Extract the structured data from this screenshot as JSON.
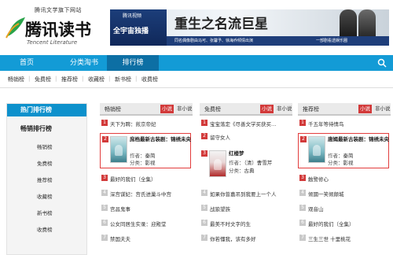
{
  "header": {
    "tagline": "腾讯文学旗下网站",
    "logo_text": "腾讯读书",
    "logo_sub": "Tencent Literature",
    "banner": {
      "brand": "腾讯视频",
      "exclusive": "全宇宙独播",
      "title": "重生之名流巨星",
      "caption": "同名偶像剧由马可、张馨予、徐海乔倾情出演",
      "caption_right": "一部剧看透娱乐圈"
    }
  },
  "nav": {
    "items": [
      "首页",
      "分类淘书",
      "排行榜"
    ],
    "active_index": 2,
    "search_icon": "search-icon"
  },
  "subnav": [
    "畅销榜",
    "免费榜",
    "推荐榜",
    "收藏榜",
    "新书榜",
    "收费榜"
  ],
  "sidebar": {
    "header": "热门排行榜",
    "section": "畅销排行榜",
    "items": [
      "畅销榜",
      "免费榜",
      "推荐榜",
      "收藏榜",
      "新书榜",
      "收费榜"
    ]
  },
  "columns": [
    {
      "title": "畅销榜",
      "tab_active": "小说",
      "tab_other": "非小说",
      "row1": "天下为聘：煎京帝妃",
      "feature": {
        "num": "2",
        "title": "庶档最新古装剧：锦绣未央",
        "author_label": "作者：",
        "author": "秦简",
        "category_label": "分类：",
        "category": "影视",
        "cover": "teal",
        "boxed": true
      },
      "rows": [
        {
          "num": "3",
          "text": "最好的我们（全集）"
        },
        {
          "num": "4",
          "text": "深宫谋妃：宫氏进巢斗中宫"
        },
        {
          "num": "5",
          "text": "宫昌鬼事"
        },
        {
          "num": "6",
          "text": "公女同居生实录：迎殿堂"
        },
        {
          "num": "7",
          "text": "禁国夫夫"
        }
      ]
    },
    {
      "title": "免费榜",
      "tab_active": "小说",
      "tab_other": "非小说",
      "row1": "宝宝落定《尽善文学买获买…",
      "feature": {
        "num": "2",
        "title": "留守女人",
        "author_label": "",
        "author": "",
        "category_label": "",
        "category": "",
        "cover": "none",
        "boxed": false
      },
      "feature2": {
        "num": "3",
        "title": "红楼梦",
        "author_label": "作者：",
        "author": "（清）曹雪芹",
        "category_label": "分类：",
        "category": "古典",
        "cover": "red"
      },
      "rows": [
        {
          "num": "4",
          "text": "如果你曾嘉吊到我要上一个人"
        },
        {
          "num": "5",
          "text": "战狼望族"
        },
        {
          "num": "6",
          "text": "最美不时文字的生"
        },
        {
          "num": "7",
          "text": "你若懂我，该有多好"
        }
      ]
    },
    {
      "title": "推荐榜",
      "tab_active": "小说",
      "tab_other": "非小说",
      "row1": "千五年等待情鸟",
      "feature": {
        "num": "2",
        "title": "唐嫣最新古装剧：锦绣未央",
        "author_label": "作者：",
        "author": "秦简",
        "category_label": "分类：",
        "category": "影视",
        "cover": "teal",
        "boxed": true
      },
      "rows": [
        {
          "num": "3",
          "text": "触警修心"
        },
        {
          "num": "4",
          "text": "倾國一笑倾颠城"
        },
        {
          "num": "5",
          "text": "观音山"
        },
        {
          "num": "6",
          "text": "最好的我们（全集）"
        },
        {
          "num": "7",
          "text": "三生三世 十里桃花"
        }
      ]
    }
  ]
}
